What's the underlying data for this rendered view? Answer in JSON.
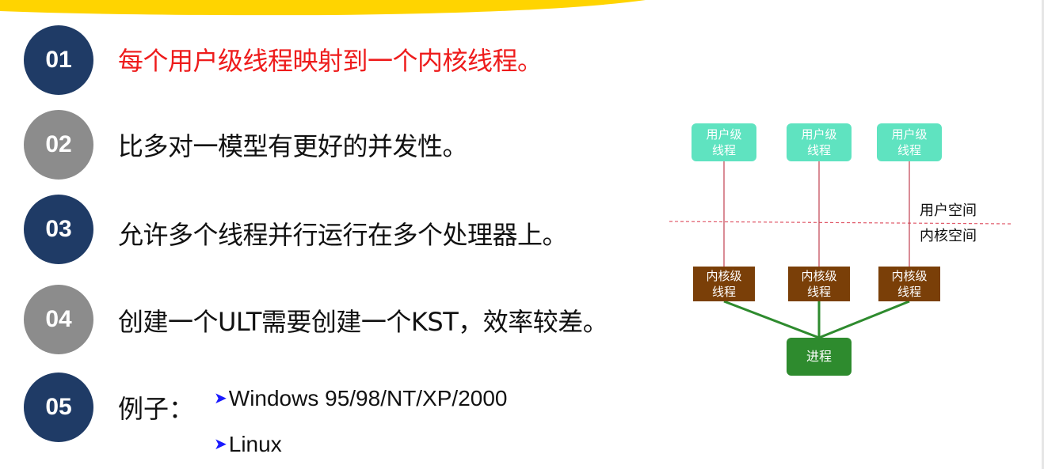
{
  "points": [
    {
      "number": "01",
      "text": "每个用户级线程映射到一个内核线程。"
    },
    {
      "number": "02",
      "text": "比多对一模型有更好的并发性。"
    },
    {
      "number": "03",
      "text": "允许多个线程并行运行在多个处理器上。"
    },
    {
      "number": "04",
      "text": "创建一个ULT需要创建一个KST，效率较差。"
    },
    {
      "number": "05",
      "text": "例子："
    }
  ],
  "examples": [
    "Windows 95/98/NT/XP/2000",
    "Linux"
  ],
  "diagram": {
    "user_threads": [
      "用户级\n线程",
      "用户级\n线程",
      "用户级\n线程"
    ],
    "kernel_threads": [
      "内核级\n线程",
      "内核级\n线程",
      "内核级\n线程"
    ],
    "process_label": "进程",
    "user_space_label": "用户空间",
    "kernel_space_label": "内核空间"
  },
  "colors": {
    "circle_dark": "#1f3b66",
    "circle_grey": "#8c8c8c",
    "highlight_red": "#ee1c1c",
    "user_thread": "#5fe3c0",
    "kernel_thread": "#7a3f08",
    "process": "#2e8b2e",
    "banner": "#ffd400"
  }
}
